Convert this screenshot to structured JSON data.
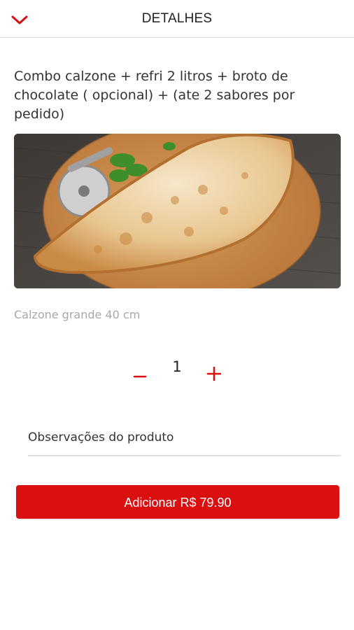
{
  "header": {
    "title": "DETALHES",
    "back_icon": "chevron-down-icon",
    "accent_color": "#d9100f"
  },
  "product": {
    "title": "Combo calzone + refri 2 litros + broto de chocolate ( opcional) + (ate 2 sabores por pedido)",
    "description": "Calzone grande 40 cm"
  },
  "quantity": {
    "value": "1",
    "minus_icon": "minus-icon",
    "plus_icon": "plus-icon"
  },
  "notes": {
    "placeholder": "Observações do produto",
    "value": ""
  },
  "add_button": {
    "prefix": "Adicionar ",
    "price": "R$ 79.90",
    "color": "#d9100f"
  }
}
